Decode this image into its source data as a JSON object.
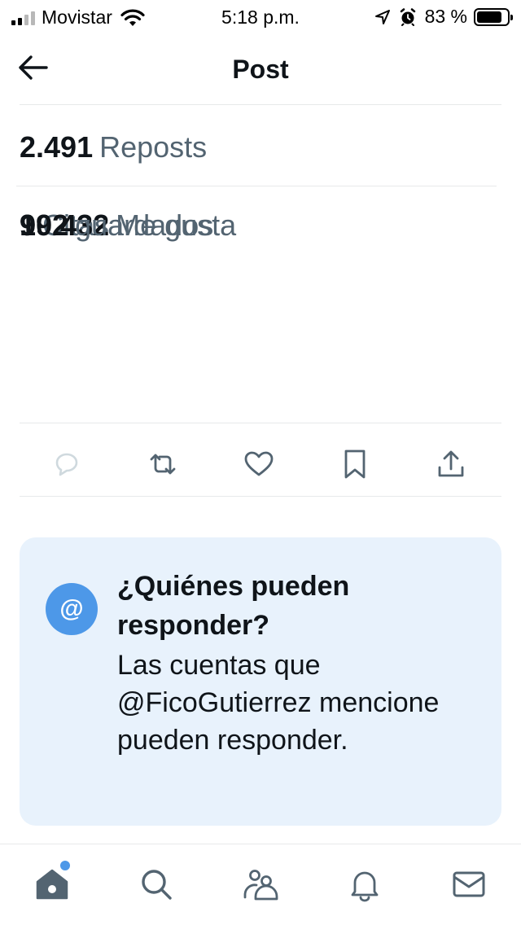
{
  "status_bar": {
    "carrier": "Movistar",
    "time": "5:18 p.m.",
    "battery_percent": "83 %",
    "battery_level": 0.83,
    "icons": [
      "signal-icon",
      "wifi-icon",
      "location-icon",
      "alarm-icon",
      "battery-icon"
    ]
  },
  "header": {
    "title": "Post",
    "back_icon": "arrow-left-icon"
  },
  "stats": {
    "reposts": {
      "count": "2.491",
      "label": "Reposts"
    },
    "overlap_layers": [
      {
        "count": "9",
        "label": "Citas"
      },
      {
        "count": "90.432",
        "label": "Me gusta"
      },
      {
        "count": "192",
        "label": "guardados"
      }
    ]
  },
  "actions": [
    {
      "name": "reply",
      "icon": "reply-icon"
    },
    {
      "name": "repost",
      "icon": "repost-icon"
    },
    {
      "name": "like",
      "icon": "heart-icon"
    },
    {
      "name": "bookmark",
      "icon": "bookmark-icon"
    },
    {
      "name": "share",
      "icon": "share-icon"
    }
  ],
  "reply_info": {
    "badge": "@",
    "title": "¿Quiénes pueden responder?",
    "body": "Las cuentas que @FicoGutierrez mencione pueden responder."
  },
  "tab_bar": {
    "tabs": [
      "home-icon",
      "search-icon",
      "communities-icon",
      "notifications-icon",
      "messages-icon"
    ],
    "active": "home-icon",
    "accent": "#4d98e8"
  },
  "colors": {
    "text": "#0f1419",
    "secondary": "#536471",
    "card_bg": "#e8f2fc",
    "accent": "#4d98e8"
  }
}
